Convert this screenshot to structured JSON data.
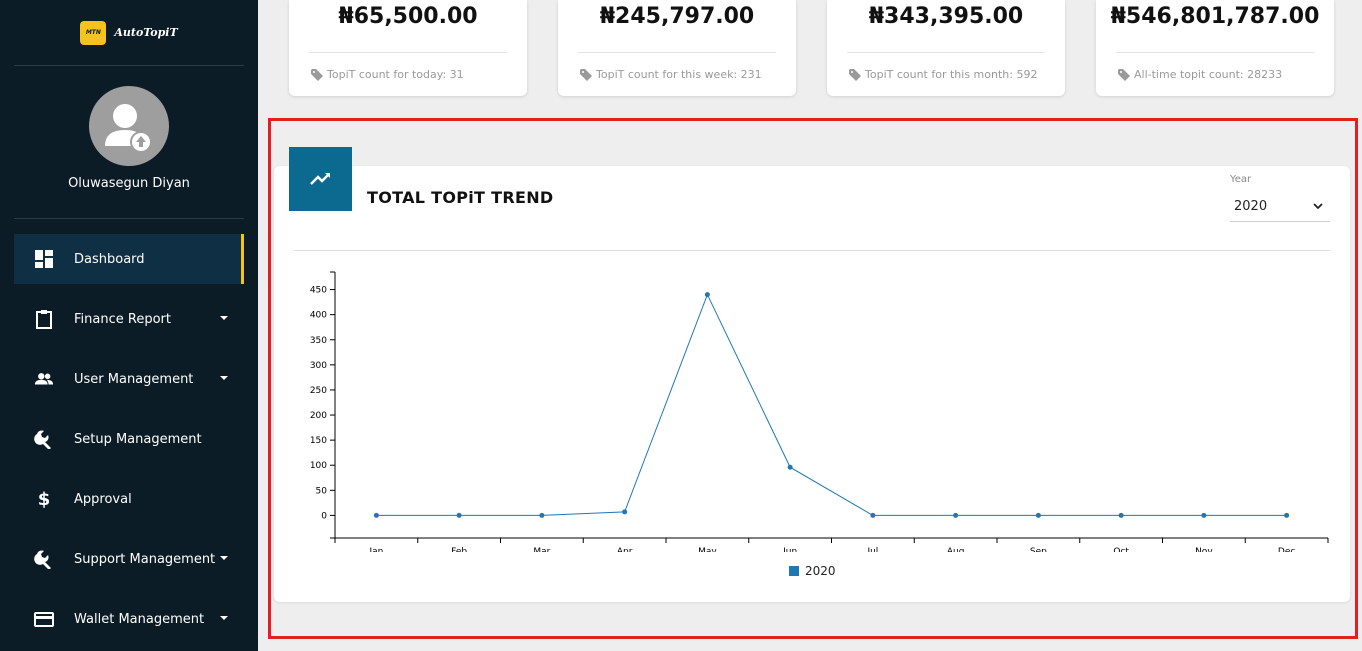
{
  "brand": {
    "logo_text": "MTN",
    "name": "AutoTopiT",
    "accent": "#f6c21c"
  },
  "profile": {
    "name": "Oluwasegun Diyan"
  },
  "sidebar": {
    "items": [
      {
        "label": "Dashboard",
        "icon": "dashboard-icon",
        "active": true
      },
      {
        "label": "Finance Report",
        "icon": "clipboard-icon",
        "caret": true
      },
      {
        "label": "User Management",
        "icon": "users-icon",
        "caret": true
      },
      {
        "label": "Setup Management",
        "icon": "wrench-icon"
      },
      {
        "label": "Approval",
        "icon": "dollar-icon"
      },
      {
        "label": "Support Management",
        "icon": "wrench-icon",
        "caret": true
      },
      {
        "label": "Wallet Management",
        "icon": "card-icon",
        "caret": true
      }
    ]
  },
  "cards": [
    {
      "value": "₦65,500.00",
      "footer": "TopiT count for today: 31"
    },
    {
      "value": "₦245,797.00",
      "footer": "TopiT count for this week: 231"
    },
    {
      "value": "₦343,395.00",
      "footer": "TopiT count for this month: 592"
    },
    {
      "value": "₦546,801,787.00",
      "footer": "All-time topit count: 28233"
    }
  ],
  "panel": {
    "title": "TOTAL TOPiT TREND",
    "icon": "trending-up-icon",
    "year_label": "Year",
    "year_value": "2020"
  },
  "colors": {
    "sidebar_bg": "#0b1c26",
    "panel_icon_bg": "#0c6a91",
    "highlight": "#e31e24",
    "series": "#1f77b4"
  },
  "chart_data": {
    "type": "line",
    "categories": [
      "Jan",
      "Feb",
      "Mar",
      "Apr",
      "May",
      "Jun",
      "Jul",
      "Aug",
      "Sep",
      "Oct",
      "Nov",
      "Dec"
    ],
    "series": [
      {
        "name": "2020",
        "values": [
          0,
          0,
          0,
          7,
          440,
          96,
          0,
          0,
          0,
          0,
          0,
          0
        ]
      }
    ],
    "yticks": [
      0,
      50,
      100,
      150,
      200,
      250,
      300,
      350,
      400,
      450
    ],
    "ylim": [
      -45,
      485
    ],
    "grid": false,
    "legend": "bottom-center"
  }
}
